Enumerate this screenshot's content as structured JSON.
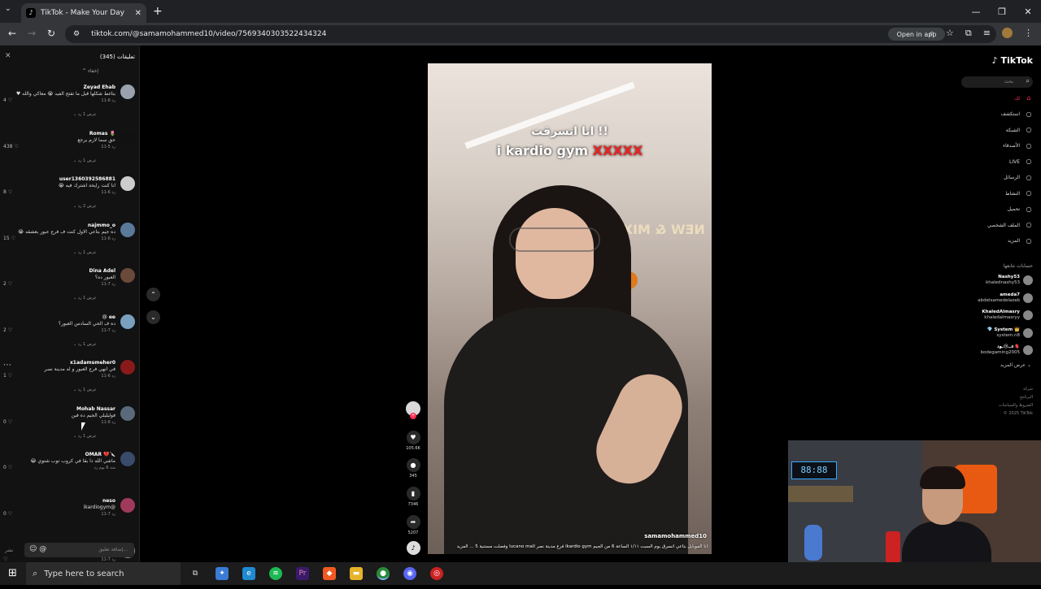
{
  "browser": {
    "tab_title": "TikTok - Make Your Day",
    "url": "tiktok.com/@samamohammed10/video/7569340303522434324",
    "open_in_app": "Open in app"
  },
  "comments": {
    "title": "تعليقات (345)",
    "hide_label": "إخفاء",
    "input_placeholder": "إضافة تعليق...",
    "post_label": "نشر",
    "items": [
      {
        "user": "Zeyad Ehab",
        "text": "بتاغط شكلها قبل ما تفتح الفيد 😭 معاكي والله ♥",
        "date": "11-6  رد",
        "likes": "4",
        "replies": "عرض 1 رد",
        "avatar_color": "#9aa3ad"
      },
      {
        "user": "Romas 🌷",
        "text": "حق سما لازم يرجع",
        "date": "11-5  رد",
        "likes": "438",
        "replies": "عرض 1 رد",
        "avatar_color": "#111111"
      },
      {
        "user": "user1360392586881",
        "text": "انا كنت رايحة اشترك فيه 😭",
        "date": "11-6  رد",
        "likes": "8",
        "replies": "عرض 2 رد",
        "avatar_color": "#cccccc"
      },
      {
        "user": "najmmo_o",
        "text": "ده جيم بتاعي الاول كنت ف فرع عبور بعشقه 😭",
        "date": "11-6  رد",
        "likes": "15",
        "replies": "عرض 1 رد",
        "avatar_color": "#5a7a9a"
      },
      {
        "user": "Dina Adel",
        "text": "العبور ده؟",
        "date": "11-7  رد",
        "likes": "2",
        "replies": "عرض 1 رد",
        "avatar_color": "#6a4a3a"
      },
      {
        "user": "😢 ee",
        "text": "ده ف الحي السادس العبور؟",
        "date": "11-7  رد",
        "likes": "2",
        "replies": "عرض 1 رد",
        "avatar_color": "#7aa0c0"
      },
      {
        "user": "x1adamsmeher0",
        "text": "في انهي فرع العبور و له مدينة نصر",
        "date": "11-6  رد",
        "likes": "1",
        "replies": "عرض 1 رد",
        "avatar_color": "#8a1a1a"
      },
      {
        "user": "Mohab Nassar",
        "text": "فوليليلي الجيم ده فين",
        "date": "11-6  رد",
        "likes": "0",
        "replies": "عرض 1 رد",
        "avatar_color": "#5a6a7a"
      },
      {
        "user": "OMAR 💔🔪",
        "text": "ماشي الله دا بقا في كروب توب شتوي 😂",
        "date": "منذ 6 يوم  رد",
        "likes": "0",
        "replies": "",
        "avatar_color": "#3a4a6a"
      },
      {
        "user": "neso",
        "text": "@ikardiogym",
        "date": "11-7  رد",
        "likes": "0",
        "replies": "",
        "avatar_color": "#a03a5a"
      },
      {
        "user": "el joks 🔴",
        "text": "كلنا ف شهرك",
        "date": "11-7  رد",
        "likes": "",
        "replies": "",
        "avatar_color": "#8a8a8a"
      }
    ]
  },
  "video": {
    "caption_line1": "انا اتسرقت !!",
    "caption_line2": "i kardio gym",
    "caption_marks": "XXXXX",
    "username": "samamohammed10",
    "description": "انا الموبايل بتاعي اتسرق يوم السبت ١/١١ الساعة 6 من الجيم ikardio gym فرع مدينة نصر lucano mall وفضلت مستنية 5 ... المزيد",
    "likes": "105.6K",
    "comments": "345",
    "saves": "7346",
    "shares": "5207"
  },
  "sidebar": {
    "logo": "TikTok",
    "search_placeholder": "بحث",
    "nav": [
      {
        "label": "لك",
        "icon": "home-icon"
      },
      {
        "label": "استكشف",
        "icon": "compass-icon"
      },
      {
        "label": "الشبكة",
        "icon": "network-icon"
      },
      {
        "label": "الأصدقاء",
        "icon": "friends-icon"
      },
      {
        "label": "LIVE",
        "icon": "live-icon"
      },
      {
        "label": "الرسائل",
        "icon": "messages-icon"
      },
      {
        "label": "النشاط",
        "icon": "activity-icon"
      },
      {
        "label": "تحميل",
        "icon": "upload-icon"
      },
      {
        "label": "الملف الشخصي",
        "icon": "profile-icon"
      },
      {
        "label": "المزيد",
        "icon": "more-icon"
      }
    ],
    "following_title": "حسابات تتابعها",
    "following": [
      {
        "name": "Nashy53",
        "handle": "khalednashy53"
      },
      {
        "name": "ameda7",
        "handle": "abdelsamedelazab"
      },
      {
        "name": "KhaledAlmasry",
        "handle": "khaledalmasryy"
      },
      {
        "name": "💎 System 👑",
        "handle": "system.n8"
      },
      {
        "name": "عــ😢ـود🫀",
        "handle": "bodegaming2005"
      }
    ],
    "see_more": "عرض المزيد",
    "footer": [
      "شركة",
      "البرنامج",
      "الشروط والسياسات",
      "© 2025 TikTok"
    ]
  },
  "webcam": {
    "clock": "88:88"
  },
  "taskbar": {
    "search_placeholder": "Type here to search"
  },
  "colors": {
    "tiktok_red": "#fe2c55",
    "panel_bg": "#121212",
    "chrome_dark": "#202124"
  }
}
